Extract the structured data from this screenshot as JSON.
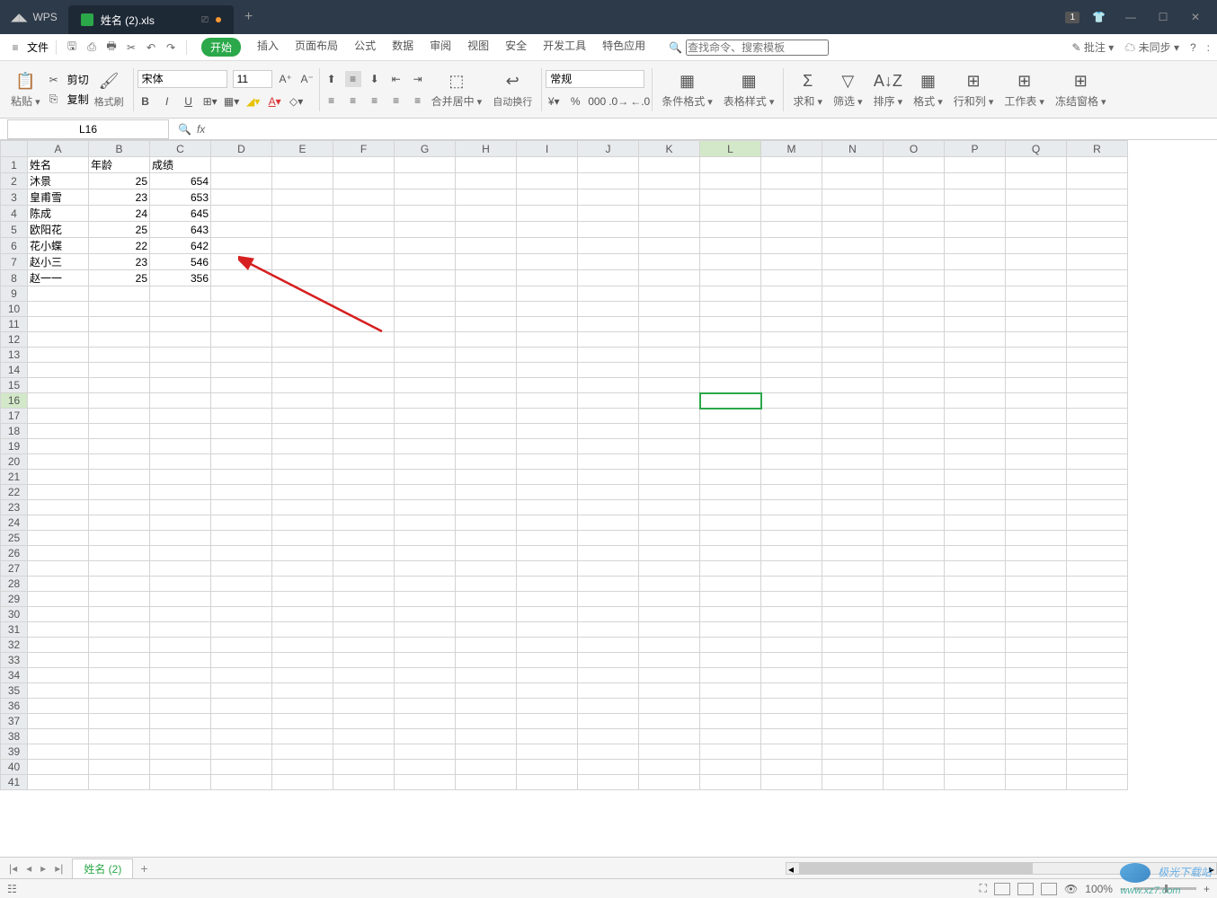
{
  "app": {
    "name": "WPS",
    "doc_tab": "姓名 (2).xls",
    "badge": "1"
  },
  "menu": {
    "file": "文件",
    "tabs": [
      "开始",
      "插入",
      "页面布局",
      "公式",
      "数据",
      "审阅",
      "视图",
      "安全",
      "开发工具",
      "特色应用"
    ],
    "active": "开始",
    "search_placeholder": "查找命令、搜索模板",
    "annotate": "批注",
    "sync": "未同步"
  },
  "ribbon": {
    "paste": "粘贴",
    "cut": "剪切",
    "copy": "复制",
    "brush": "格式刷",
    "font": "宋体",
    "size": "11",
    "merge": "合并居中",
    "wrap": "自动换行",
    "number_fmt": "常规",
    "cond": "条件格式",
    "tblstyle": "表格样式",
    "sum": "求和",
    "filter": "筛选",
    "sort": "排序",
    "fmt": "格式",
    "rowcol": "行和列",
    "worksheet": "工作表",
    "freeze": "冻结窗格"
  },
  "cellref": "L16",
  "columns": [
    "A",
    "B",
    "C",
    "D",
    "E",
    "F",
    "G",
    "H",
    "I",
    "J",
    "K",
    "L",
    "M",
    "N",
    "O",
    "P",
    "Q",
    "R"
  ],
  "rows": 41,
  "data": {
    "headers": [
      "姓名",
      "年龄",
      "成绩"
    ],
    "rows": [
      [
        "沐景",
        "25",
        "654"
      ],
      [
        "皇甫雪",
        "23",
        "653"
      ],
      [
        "陈成",
        "24",
        "645"
      ],
      [
        "欧阳花",
        "25",
        "643"
      ],
      [
        "花小蝶",
        "22",
        "642"
      ],
      [
        "赵小三",
        "23",
        "546"
      ],
      [
        "赵一一",
        "25",
        "356"
      ]
    ]
  },
  "sheet_tab": "姓名 (2)",
  "zoom": "100%",
  "watermark": {
    "name": "极光下载站",
    "url": "www.xz7.com"
  }
}
